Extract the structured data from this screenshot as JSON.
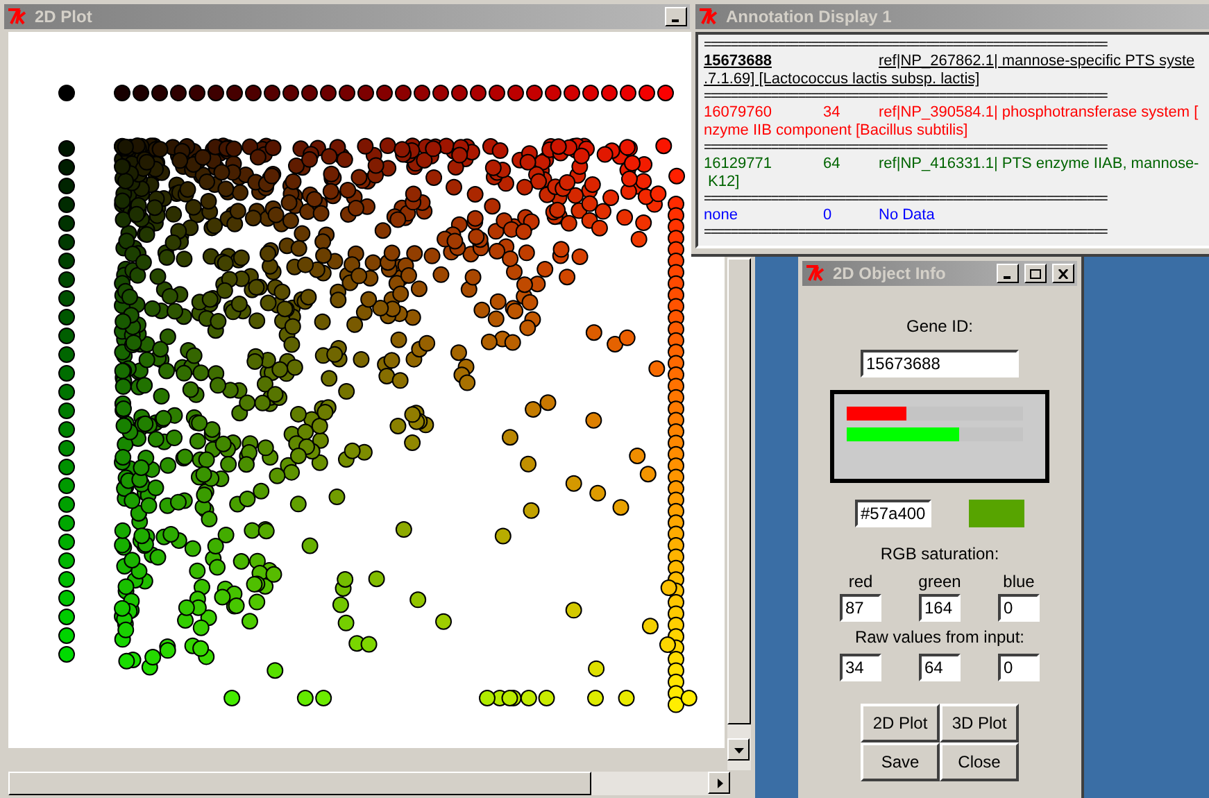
{
  "plot_window": {
    "title": "2D Plot"
  },
  "annotation_window": {
    "title": "Annotation Display 1",
    "separator": "============================================================",
    "entries": [
      {
        "id": "15673688",
        "description": "ref|NP_267862.1| mannose-specific PTS syste",
        "continuation": ".7.1.69] [Lactococcus lactis subsp. lactis]",
        "color": "#000000",
        "selected": true
      },
      {
        "id": "16079760",
        "score": "34",
        "description": "ref|NP_390584.1| phosphotransferase system [",
        "continuation": "nzyme IIB component [Bacillus subtilis]",
        "color": "#ff0000",
        "selected": false
      },
      {
        "id": "16129771",
        "score": "64",
        "description": "ref|NP_416331.1| PTS enzyme IIAB, mannose-",
        "continuation": " K12]",
        "color": "#006400",
        "selected": false
      },
      {
        "id": "none",
        "score": "0",
        "description": "No Data",
        "color": "#0000ff",
        "selected": false
      }
    ]
  },
  "info_window": {
    "title": "2D Object Info",
    "gene_label": "Gene ID:",
    "gene_id": "15673688",
    "bars": [
      {
        "color": "#ff0000",
        "level": 0.34
      },
      {
        "color": "#00ff00",
        "level": 0.64
      }
    ],
    "hex": "#57a400",
    "swatch": {
      "color": "#57a400"
    },
    "rgb_label": "RGB saturation:",
    "channel_labels": [
      "red",
      "green",
      "blue"
    ],
    "rgb_values": [
      "87",
      "164",
      "0"
    ],
    "raw_label": "Raw values from input:",
    "raw_values": [
      "34",
      "64",
      "0"
    ],
    "buttons": [
      "2D Plot",
      "3D Plot",
      "Save",
      "Close"
    ]
  }
}
